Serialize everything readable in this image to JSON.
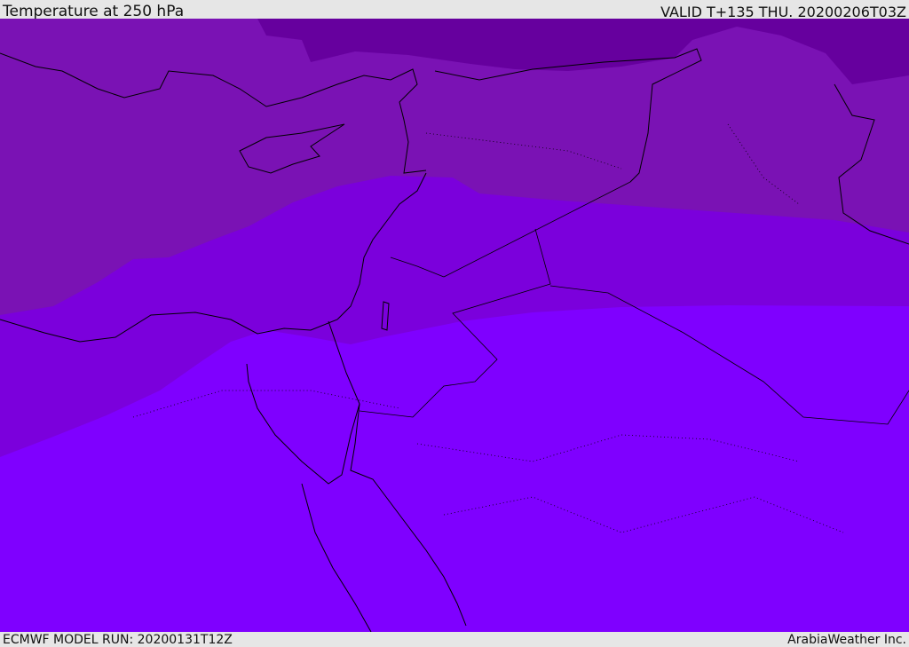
{
  "header": {
    "title": "Temperature at 250 hPa",
    "valid": "VALID T+135 THU. 20200206T03Z"
  },
  "footer": {
    "model_run": "ECMWF MODEL RUN: 20200131T12Z",
    "brand": "ArabiaWeather Inc."
  },
  "map": {
    "variable": "Temperature",
    "level_hpa": 250,
    "colors": {
      "coldest": "#66009e",
      "cold": "#7a12b4",
      "mid": "#7b00dc",
      "warm": "#7f00ff",
      "border": "#000000"
    }
  }
}
